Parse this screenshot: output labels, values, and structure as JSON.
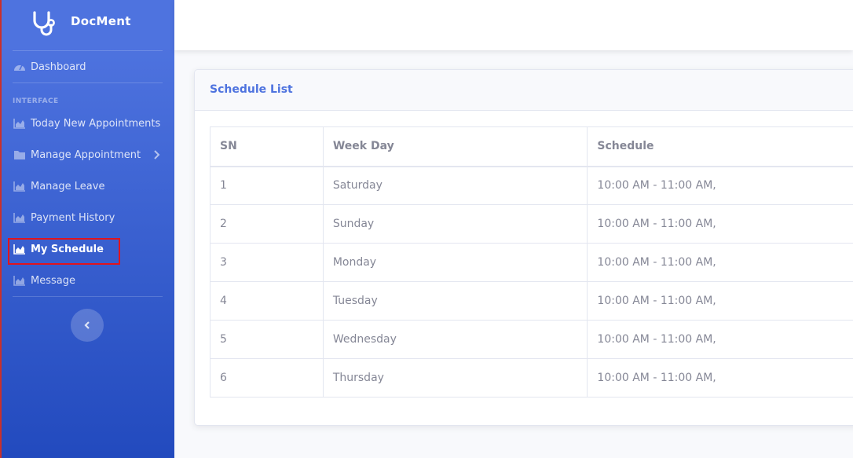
{
  "brand": {
    "name": "DocMent"
  },
  "sidebar": {
    "dashboard": "Dashboard",
    "heading": "INTERFACE",
    "items": [
      {
        "label": "Today New Appointments"
      },
      {
        "label": "Manage Appointment"
      },
      {
        "label": "Manage Leave"
      },
      {
        "label": "Payment History"
      },
      {
        "label": "My Schedule"
      },
      {
        "label": "Message"
      }
    ]
  },
  "card": {
    "title": "Schedule List"
  },
  "table": {
    "headers": [
      "SN",
      "Week Day",
      "Schedule"
    ],
    "rows": [
      [
        "1",
        "Saturday",
        "10:00 AM - 11:00 AM,"
      ],
      [
        "2",
        "Sunday",
        "10:00 AM - 11:00 AM,"
      ],
      [
        "3",
        "Monday",
        "10:00 AM - 11:00 AM,"
      ],
      [
        "4",
        "Tuesday",
        "10:00 AM - 11:00 AM,"
      ],
      [
        "5",
        "Wednesday",
        "10:00 AM - 11:00 AM,"
      ],
      [
        "6",
        "Thursday",
        "10:00 AM - 11:00 AM,"
      ]
    ]
  },
  "colors": {
    "accent": "#4e73df",
    "sidebar_bottom": "#224abe",
    "highlight": "#e0141d"
  }
}
